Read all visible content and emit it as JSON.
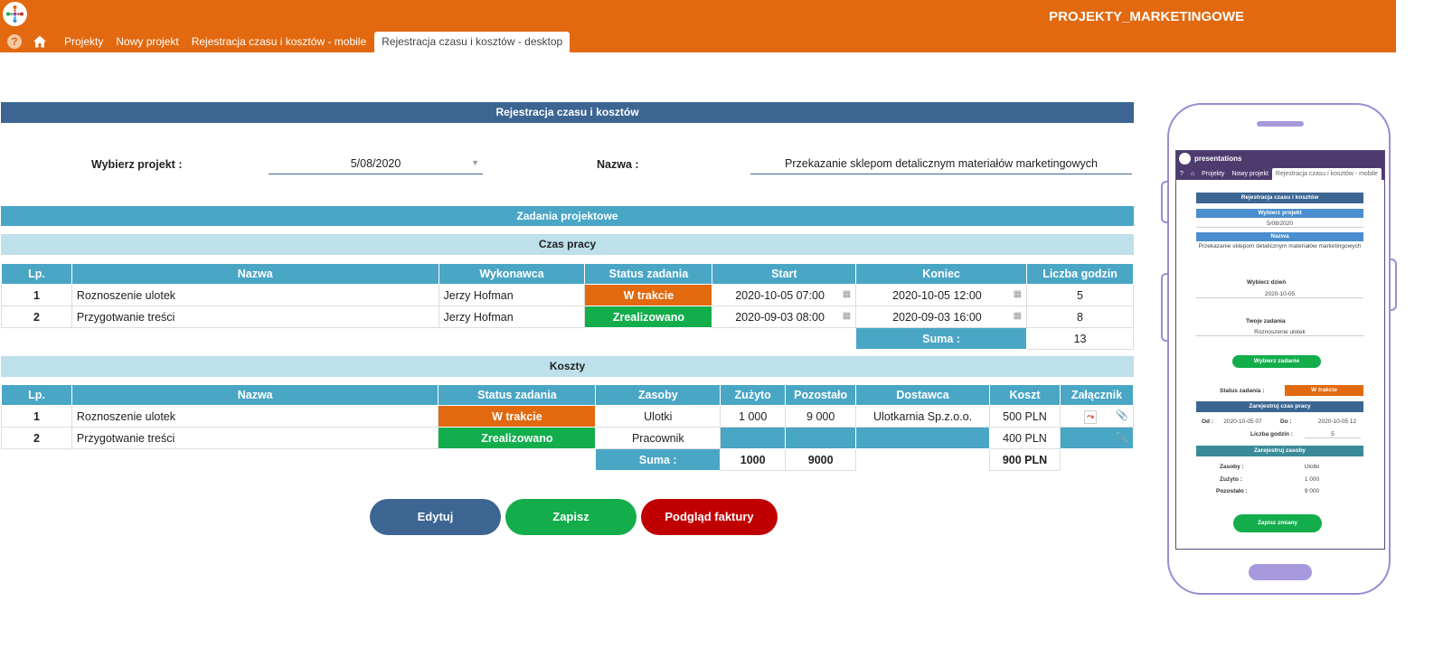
{
  "header": {
    "app_title": "PROJEKTY_MARKETINGOWE",
    "nav": {
      "help": "?",
      "items": [
        "Projekty",
        "Nowy projekt",
        "Rejestracja czasu i kosztów - mobile",
        "Rejestracja czasu i kosztów - desktop"
      ]
    }
  },
  "main": {
    "title": "Rejestracja czasu i kosztów",
    "project_label": "Wybierz projekt :",
    "project_value": "5/08/2020",
    "name_label": "Nazwa :",
    "name_value": "Przekazanie sklepom detalicznym materiałów marketingowych",
    "tasks_header": "Zadania projektowe",
    "work_time": {
      "header": "Czas pracy",
      "columns": [
        "Lp.",
        "Nazwa",
        "Wykonawca",
        "Status zadania",
        "Start",
        "Koniec",
        "Liczba godzin"
      ],
      "rows": [
        {
          "lp": "1",
          "name": "Roznoszenie ulotek",
          "executor": "Jerzy Hofman",
          "status": "W trakcie",
          "start": "2020-10-05 07:00",
          "end": "2020-10-05 12:00",
          "hours": "5"
        },
        {
          "lp": "2",
          "name": "Przygotwanie treści",
          "executor": "Jerzy Hofman",
          "status": "Zrealizowano",
          "start": "2020-09-03 08:00",
          "end": "2020-09-03 16:00",
          "hours": "8"
        }
      ],
      "sum_label": "Suma :",
      "sum_hours": "13"
    },
    "costs": {
      "header": "Koszty",
      "columns": [
        "Lp.",
        "Nazwa",
        "Status zadania",
        "Zasoby",
        "Zużyto",
        "Pozostało",
        "Dostawca",
        "Koszt",
        "Załącznik"
      ],
      "rows": [
        {
          "lp": "1",
          "name": "Roznoszenie ulotek",
          "status": "W trakcie",
          "resources": "Ulotki",
          "used": "1 000",
          "left": "9 000",
          "supplier": "Ulotkarnia Sp.z.o.o.",
          "cost": "500 PLN"
        },
        {
          "lp": "2",
          "name": "Przygotwanie treści",
          "status": "Zrealizowano",
          "resources": "Pracownik",
          "used": "",
          "left": "",
          "supplier": "",
          "cost": "400 PLN"
        }
      ],
      "sum_label": "Suma :",
      "sum_used": "1000",
      "sum_left": "9000",
      "sum_cost": "900 PLN"
    },
    "buttons": {
      "edit": "Edytuj",
      "save": "Zapisz",
      "invoice": "Podgląd faktury"
    }
  },
  "mobile": {
    "app_name": "presentations",
    "nav": [
      "Projekty",
      "Nowy projekt",
      "Rejestracja czasu i kosztów - mobile"
    ],
    "title": "Rejestracja czasu i kosztów",
    "project_label": "Wybierz projekt",
    "project_value": "5/08/2020",
    "name_label": "Nazwa",
    "name_value": "Przekazanie sklepom detalicznym materiałów marketingowych",
    "day_label": "Wybierz dzień",
    "day_value": "2020-10-05",
    "tasks_label": "Twoje zadania",
    "task_value": "Roznoszenie ulotek",
    "choose_task": "Wybierz zadanie",
    "status_label": "Status zadania :",
    "status_value": "W trakcie",
    "register_time": "Zarejestruj czas pracy",
    "from_label": "Od :",
    "from_value": "2020-10-05 07",
    "to_label": "Do :",
    "to_value": "2020-10-05 12",
    "hours_label": "Liczba godzin :",
    "hours_value": "5",
    "register_resources": "Zarejestruj zasoby",
    "res_label": "Zasoby :",
    "res_value": "Ulotki",
    "used_label": "Zużyto :",
    "used_value": "1 000",
    "left_label": "Pozostało :",
    "left_value": "9 000",
    "save_changes": "Zapisz zmiany"
  },
  "colors": {
    "orange": "#e2690f",
    "navy": "#3c6592",
    "teal": "#4aa6c5",
    "green": "#13ad4c",
    "red": "#c00000"
  }
}
